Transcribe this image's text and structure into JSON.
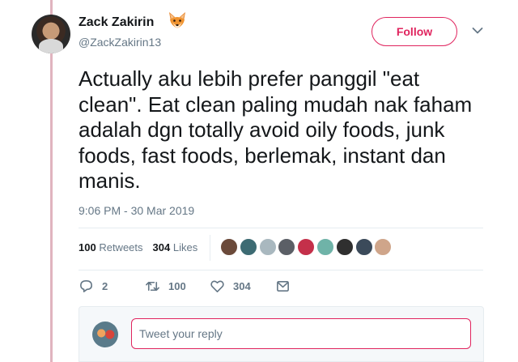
{
  "tweet": {
    "author_name": "Zack Zakirin",
    "name_emoji": "fox-face-emoji",
    "handle": "@ZackZakirin13",
    "follow_label": "Follow",
    "text": "Actually aku lebih prefer panggil \"eat clean\". Eat clean paling mudah nak faham adalah dgn totally avoid oily foods, junk foods, fast foods, berlemak, instant dan manis.",
    "timestamp": "9:06 PM - 30 Mar 2019"
  },
  "stats": {
    "retweets_count": "100",
    "retweets_label": "Retweets",
    "likes_count": "304",
    "likes_label": "Likes"
  },
  "likers": [
    "#6b4a3a",
    "#3d6b73",
    "#a9b8bf",
    "#5b5f66",
    "#c4304a",
    "#6fb3a8",
    "#2f2f2f",
    "#3b4a5a",
    "#cfa58a"
  ],
  "actions": {
    "reply_count": "2",
    "retweet_count": "100",
    "like_count": "304"
  },
  "reply": {
    "placeholder": "Tweet your reply"
  },
  "colors": {
    "accent": "#e0245e",
    "muted": "#657786",
    "thread_line": "#e0b4bf"
  }
}
